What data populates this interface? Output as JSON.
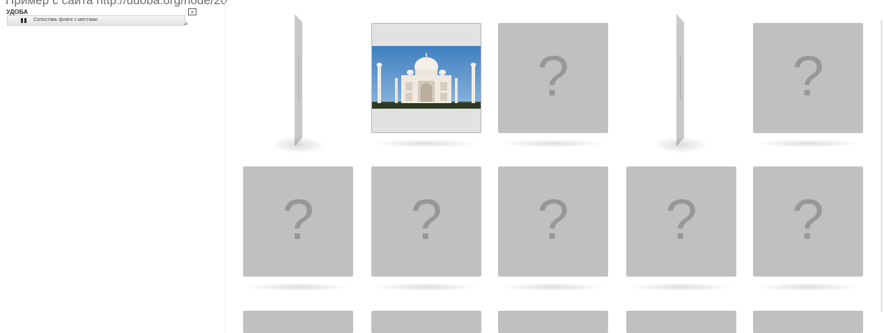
{
  "page": {
    "caption": "Пример с сайта http://udoba.org/node/20"
  },
  "app": {
    "name": "УДОБА",
    "close_label": "×",
    "exercise_title": "Сопоставь флаги с местами"
  },
  "board": {
    "unknown_symbol": "?",
    "cards": [
      {
        "row": 1,
        "col": 1,
        "state": "flipping"
      },
      {
        "row": 1,
        "col": 2,
        "state": "revealed",
        "image": "taj-mahal"
      },
      {
        "row": 1,
        "col": 3,
        "state": "hidden"
      },
      {
        "row": 1,
        "col": 4,
        "state": "flipping"
      },
      {
        "row": 1,
        "col": 5,
        "state": "hidden"
      },
      {
        "row": 2,
        "col": 1,
        "state": "hidden"
      },
      {
        "row": 2,
        "col": 2,
        "state": "hidden"
      },
      {
        "row": 2,
        "col": 3,
        "state": "hidden"
      },
      {
        "row": 2,
        "col": 4,
        "state": "hidden"
      },
      {
        "row": 2,
        "col": 5,
        "state": "hidden"
      },
      {
        "row": 3,
        "col": 1,
        "state": "hidden"
      },
      {
        "row": 3,
        "col": 2,
        "state": "hidden"
      },
      {
        "row": 3,
        "col": 3,
        "state": "hidden"
      },
      {
        "row": 3,
        "col": 4,
        "state": "hidden"
      },
      {
        "row": 3,
        "col": 5,
        "state": "hidden"
      }
    ]
  },
  "colors": {
    "card_back": "#c0c0c0",
    "question_mark": "#979797",
    "revealed_background": "#e2e2e2",
    "sky": "#3f7fc0"
  }
}
